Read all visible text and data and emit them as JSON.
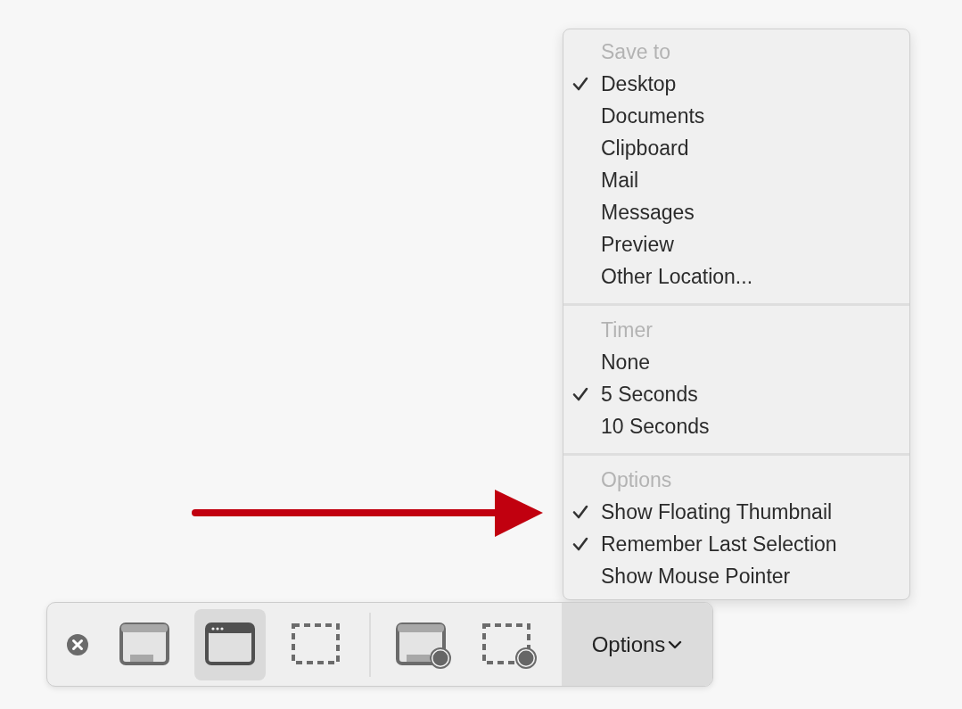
{
  "menu": {
    "sections": [
      {
        "header": "Save to",
        "items": [
          {
            "label": "Desktop",
            "checked": true
          },
          {
            "label": "Documents",
            "checked": false
          },
          {
            "label": "Clipboard",
            "checked": false
          },
          {
            "label": "Mail",
            "checked": false
          },
          {
            "label": "Messages",
            "checked": false
          },
          {
            "label": "Preview",
            "checked": false
          },
          {
            "label": "Other Location...",
            "checked": false
          }
        ]
      },
      {
        "header": "Timer",
        "items": [
          {
            "label": "None",
            "checked": false
          },
          {
            "label": "5 Seconds",
            "checked": true
          },
          {
            "label": "10 Seconds",
            "checked": false
          }
        ]
      },
      {
        "header": "Options",
        "items": [
          {
            "label": "Show Floating Thumbnail",
            "checked": true
          },
          {
            "label": "Remember Last Selection",
            "checked": true
          },
          {
            "label": "Show Mouse Pointer",
            "checked": false
          }
        ]
      }
    ]
  },
  "toolbar": {
    "tools": [
      {
        "kind": "close"
      },
      {
        "kind": "screen",
        "selected": false
      },
      {
        "kind": "window",
        "selected": true
      },
      {
        "kind": "selection",
        "selected": false
      },
      {
        "kind": "separator"
      },
      {
        "kind": "record-screen",
        "selected": false
      },
      {
        "kind": "record-selection",
        "selected": false
      }
    ],
    "options_button": {
      "label": "Options"
    }
  }
}
